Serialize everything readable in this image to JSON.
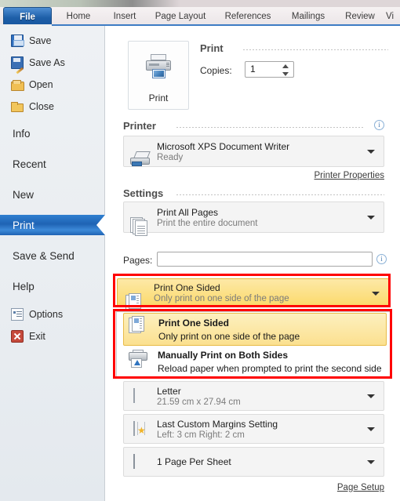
{
  "window": {
    "app": "Microsoft Word 2010 Backstage",
    "ribbon_tabs": [
      {
        "label": "File",
        "active": true
      },
      {
        "label": "Home",
        "active": false
      },
      {
        "label": "Insert",
        "active": false
      },
      {
        "label": "Page Layout",
        "active": false
      },
      {
        "label": "References",
        "active": false
      },
      {
        "label": "Mailings",
        "active": false
      },
      {
        "label": "Review",
        "active": false
      },
      {
        "label": "Vi",
        "active": false
      }
    ]
  },
  "sidebar": {
    "commands": [
      {
        "label": "Save",
        "icon": "floppy-disk-icon"
      },
      {
        "label": "Save As",
        "icon": "floppy-disk-pencil-icon"
      },
      {
        "label": "Open",
        "icon": "open-folder-icon"
      },
      {
        "label": "Close",
        "icon": "folder-icon"
      }
    ],
    "sections": [
      {
        "label": "Info",
        "active": false
      },
      {
        "label": "Recent",
        "active": false
      },
      {
        "label": "New",
        "active": false
      },
      {
        "label": "Print",
        "active": true
      },
      {
        "label": "Save & Send",
        "active": false
      },
      {
        "label": "Help",
        "active": false
      }
    ],
    "bottom": [
      {
        "label": "Options",
        "icon": "options-icon"
      },
      {
        "label": "Exit",
        "icon": "exit-icon"
      }
    ]
  },
  "print_pane": {
    "print_button_label": "Print",
    "heading": "Print",
    "copies_label": "Copies:",
    "copies_value": "1",
    "printer_heading": "Printer",
    "printer_name": "Microsoft XPS Document Writer",
    "printer_status": "Ready",
    "printer_properties_link": "Printer Properties",
    "settings_heading": "Settings",
    "print_range": {
      "title": "Print All Pages",
      "subtitle": "Print the entire document"
    },
    "pages_label": "Pages:",
    "pages_value": "",
    "duplex_combo": {
      "title": "Print One Sided",
      "subtitle": "Only print on one side of the page"
    },
    "duplex_options": [
      {
        "title": "Print One Sided",
        "subtitle": "Only print on one side of the page",
        "selected": true,
        "icon": "one-sided-page-icon"
      },
      {
        "title": "Manually Print on Both Sides",
        "subtitle": "Reload paper when prompted to print the second side",
        "selected": false,
        "icon": "duplex-printer-icon"
      }
    ],
    "paper_size": {
      "title": "Letter",
      "subtitle": "21.59 cm x 27.94 cm"
    },
    "margins": {
      "title": "Last Custom Margins Setting",
      "subtitle": "Left:  3 cm    Right:  2 cm"
    },
    "pages_per_sheet": {
      "title": "1 Page Per Sheet"
    },
    "page_setup_link": "Page Setup"
  },
  "colors": {
    "accent_blue": "#1f63b4",
    "highlight_yellow": "#fbd96a",
    "annotation_red": "#ff0000",
    "panel_bg": "#ffffff",
    "sidebar_bg": "#e9edf1"
  }
}
